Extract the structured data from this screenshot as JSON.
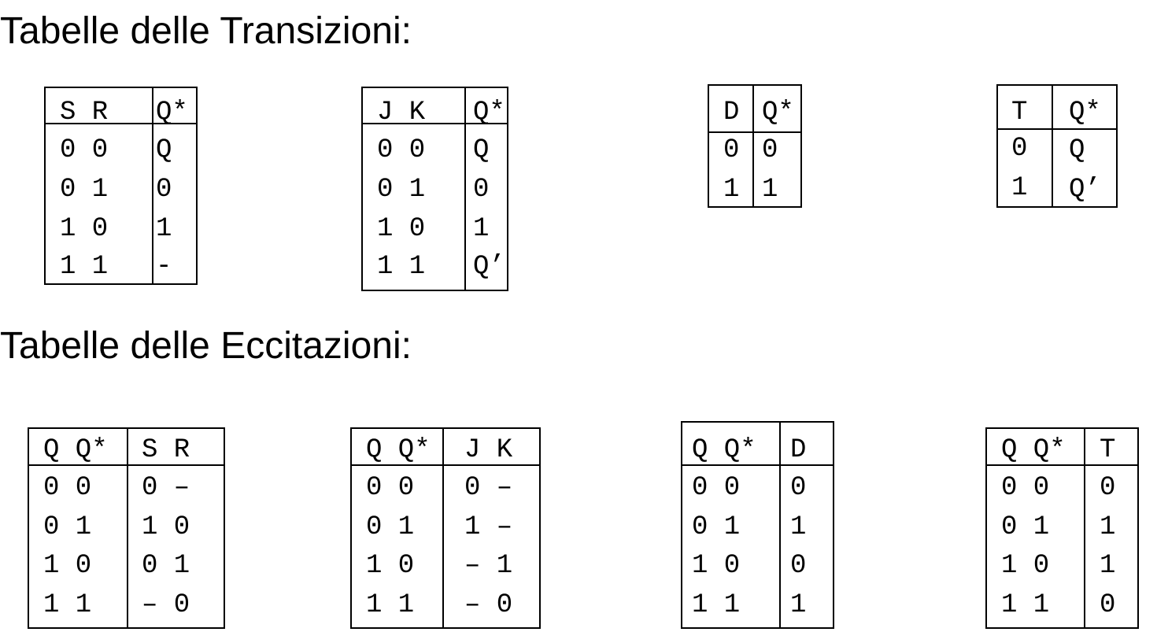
{
  "sections": {
    "transitions_title": "Tabelle delle Transizioni:",
    "excitations_title": "Tabelle delle Eccitazioni:"
  },
  "transition_tables": [
    {
      "name": "SR",
      "inputs_header": "S R",
      "output_header": "Q*",
      "rows": [
        {
          "inputs": "0 0",
          "output": "Q"
        },
        {
          "inputs": "0 1",
          "output": "0"
        },
        {
          "inputs": "1 0",
          "output": "1"
        },
        {
          "inputs": "1 1",
          "output": "-"
        }
      ]
    },
    {
      "name": "JK",
      "inputs_header": "J K",
      "output_header": "Q*",
      "rows": [
        {
          "inputs": "0 0",
          "output": "Q"
        },
        {
          "inputs": "0 1",
          "output": "0"
        },
        {
          "inputs": "1 0",
          "output": "1"
        },
        {
          "inputs": "1 1",
          "output": "Q’"
        }
      ]
    },
    {
      "name": "D",
      "inputs_header": "D",
      "output_header": "Q*",
      "rows": [
        {
          "inputs": "0",
          "output": "0"
        },
        {
          "inputs": "1",
          "output": "1"
        }
      ]
    },
    {
      "name": "T",
      "inputs_header": "T",
      "output_header": "Q*",
      "rows": [
        {
          "inputs": "0",
          "output": "Q"
        },
        {
          "inputs": "1",
          "output": "Q’"
        }
      ]
    }
  ],
  "excitation_tables": [
    {
      "name": "SR",
      "states_header": "Q Q*",
      "inputs_header": "S R",
      "rows": [
        {
          "states": "0 0",
          "inputs": "0 –"
        },
        {
          "states": "0 1",
          "inputs": "1 0"
        },
        {
          "states": "1 0",
          "inputs": "0 1"
        },
        {
          "states": "1 1",
          "inputs": "– 0"
        }
      ]
    },
    {
      "name": "JK",
      "states_header": "Q Q*",
      "inputs_header": "J K",
      "rows": [
        {
          "states": "0 0",
          "inputs": "0 –"
        },
        {
          "states": "0 1",
          "inputs": "1 –"
        },
        {
          "states": "1 0",
          "inputs": "– 1"
        },
        {
          "states": "1 1",
          "inputs": "– 0"
        }
      ]
    },
    {
      "name": "D",
      "states_header": "Q Q*",
      "inputs_header": "D",
      "rows": [
        {
          "states": "0 0",
          "inputs": "0"
        },
        {
          "states": "0 1",
          "inputs": "1"
        },
        {
          "states": "1 0",
          "inputs": "0"
        },
        {
          "states": "1 1",
          "inputs": "1"
        }
      ]
    },
    {
      "name": "T",
      "states_header": "Q Q*",
      "inputs_header": "T",
      "rows": [
        {
          "states": "0 0",
          "inputs": "0"
        },
        {
          "states": "0 1",
          "inputs": "1"
        },
        {
          "states": "1 0",
          "inputs": "1"
        },
        {
          "states": "1 1",
          "inputs": "0"
        }
      ]
    }
  ]
}
